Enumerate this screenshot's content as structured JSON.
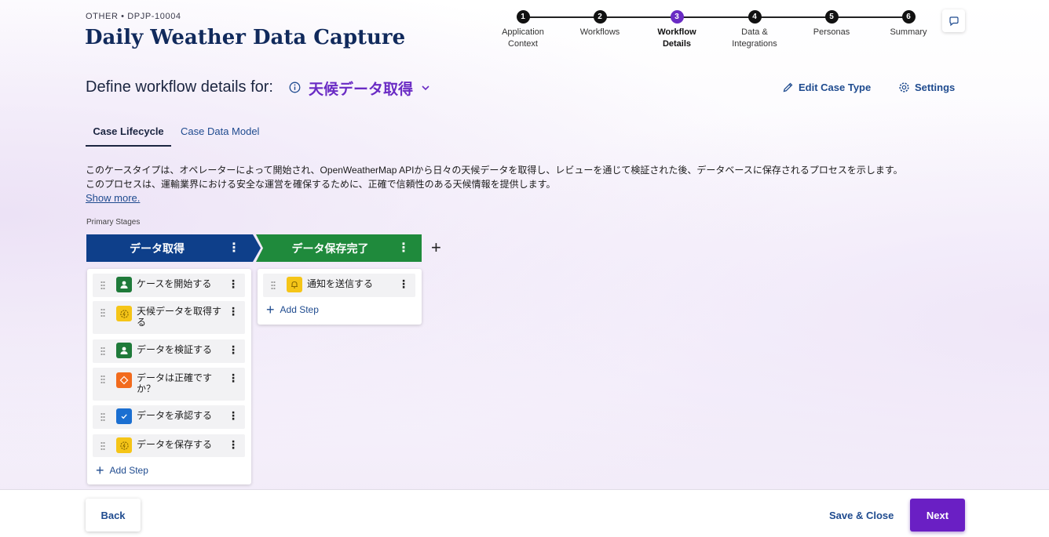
{
  "header": {
    "case_id": "OTHER • DPJP-10004",
    "title": "Daily Weather Data Capture"
  },
  "stepper": {
    "steps": [
      {
        "number": "1",
        "line1": "Application",
        "line2": "Context",
        "active": false
      },
      {
        "number": "2",
        "line1": "Workflows",
        "line2": "",
        "active": false
      },
      {
        "number": "3",
        "line1": "Workflow",
        "line2": "Details",
        "active": true
      },
      {
        "number": "4",
        "line1": "Data &",
        "line2": "Integrations",
        "active": false
      },
      {
        "number": "5",
        "line1": "Personas",
        "line2": "",
        "active": false
      },
      {
        "number": "6",
        "line1": "Summary",
        "line2": "",
        "active": false
      }
    ]
  },
  "workflow": {
    "define_label": "Define workflow details for:",
    "case_type": "天候データ取得",
    "edit_case_type": "Edit Case Type",
    "settings": "Settings"
  },
  "tabs": {
    "case_lifecycle": "Case Lifecycle",
    "case_data_model": "Case Data Model"
  },
  "description": {
    "line1": "このケースタイプは、オペレーターによって開始され、OpenWeatherMap APIから日々の天候データを取得し、レビューを通じて検証された後、データベースに保存されるプロセスを示します。",
    "line2": "このプロセスは、運輸業界における安全な運営を確保するために、正確で信頼性のある天候情報を提供します。",
    "show_more": "Show more."
  },
  "lifecycle": {
    "primary_stages_label": "Primary Stages",
    "add_step_label": "Add Step",
    "stages": [
      {
        "name": "データ取得",
        "color": "#0e3f8a",
        "steps": [
          {
            "label": "ケースを開始する",
            "icon": "person-icon",
            "color": "#1f7a3a"
          },
          {
            "label": "天候データを取得する",
            "icon": "automation-icon",
            "color": "#f5c518"
          },
          {
            "label": "データを検証する",
            "icon": "person-icon",
            "color": "#1f7a3a"
          },
          {
            "label": "データは正確ですか？",
            "icon": "decision-icon",
            "color": "#f26b1d"
          },
          {
            "label": "データを承認する",
            "icon": "approval-icon",
            "color": "#1b6fd1"
          },
          {
            "label": "データを保存する",
            "icon": "automation-icon",
            "color": "#f5c518"
          }
        ]
      },
      {
        "name": "データ保存完了",
        "color": "#1f8a3c",
        "steps": [
          {
            "label": "通知を送信する",
            "icon": "bell-icon",
            "color": "#f5c518"
          }
        ]
      }
    ]
  },
  "footer": {
    "back": "Back",
    "save_close": "Save & Close",
    "next": "Next"
  }
}
